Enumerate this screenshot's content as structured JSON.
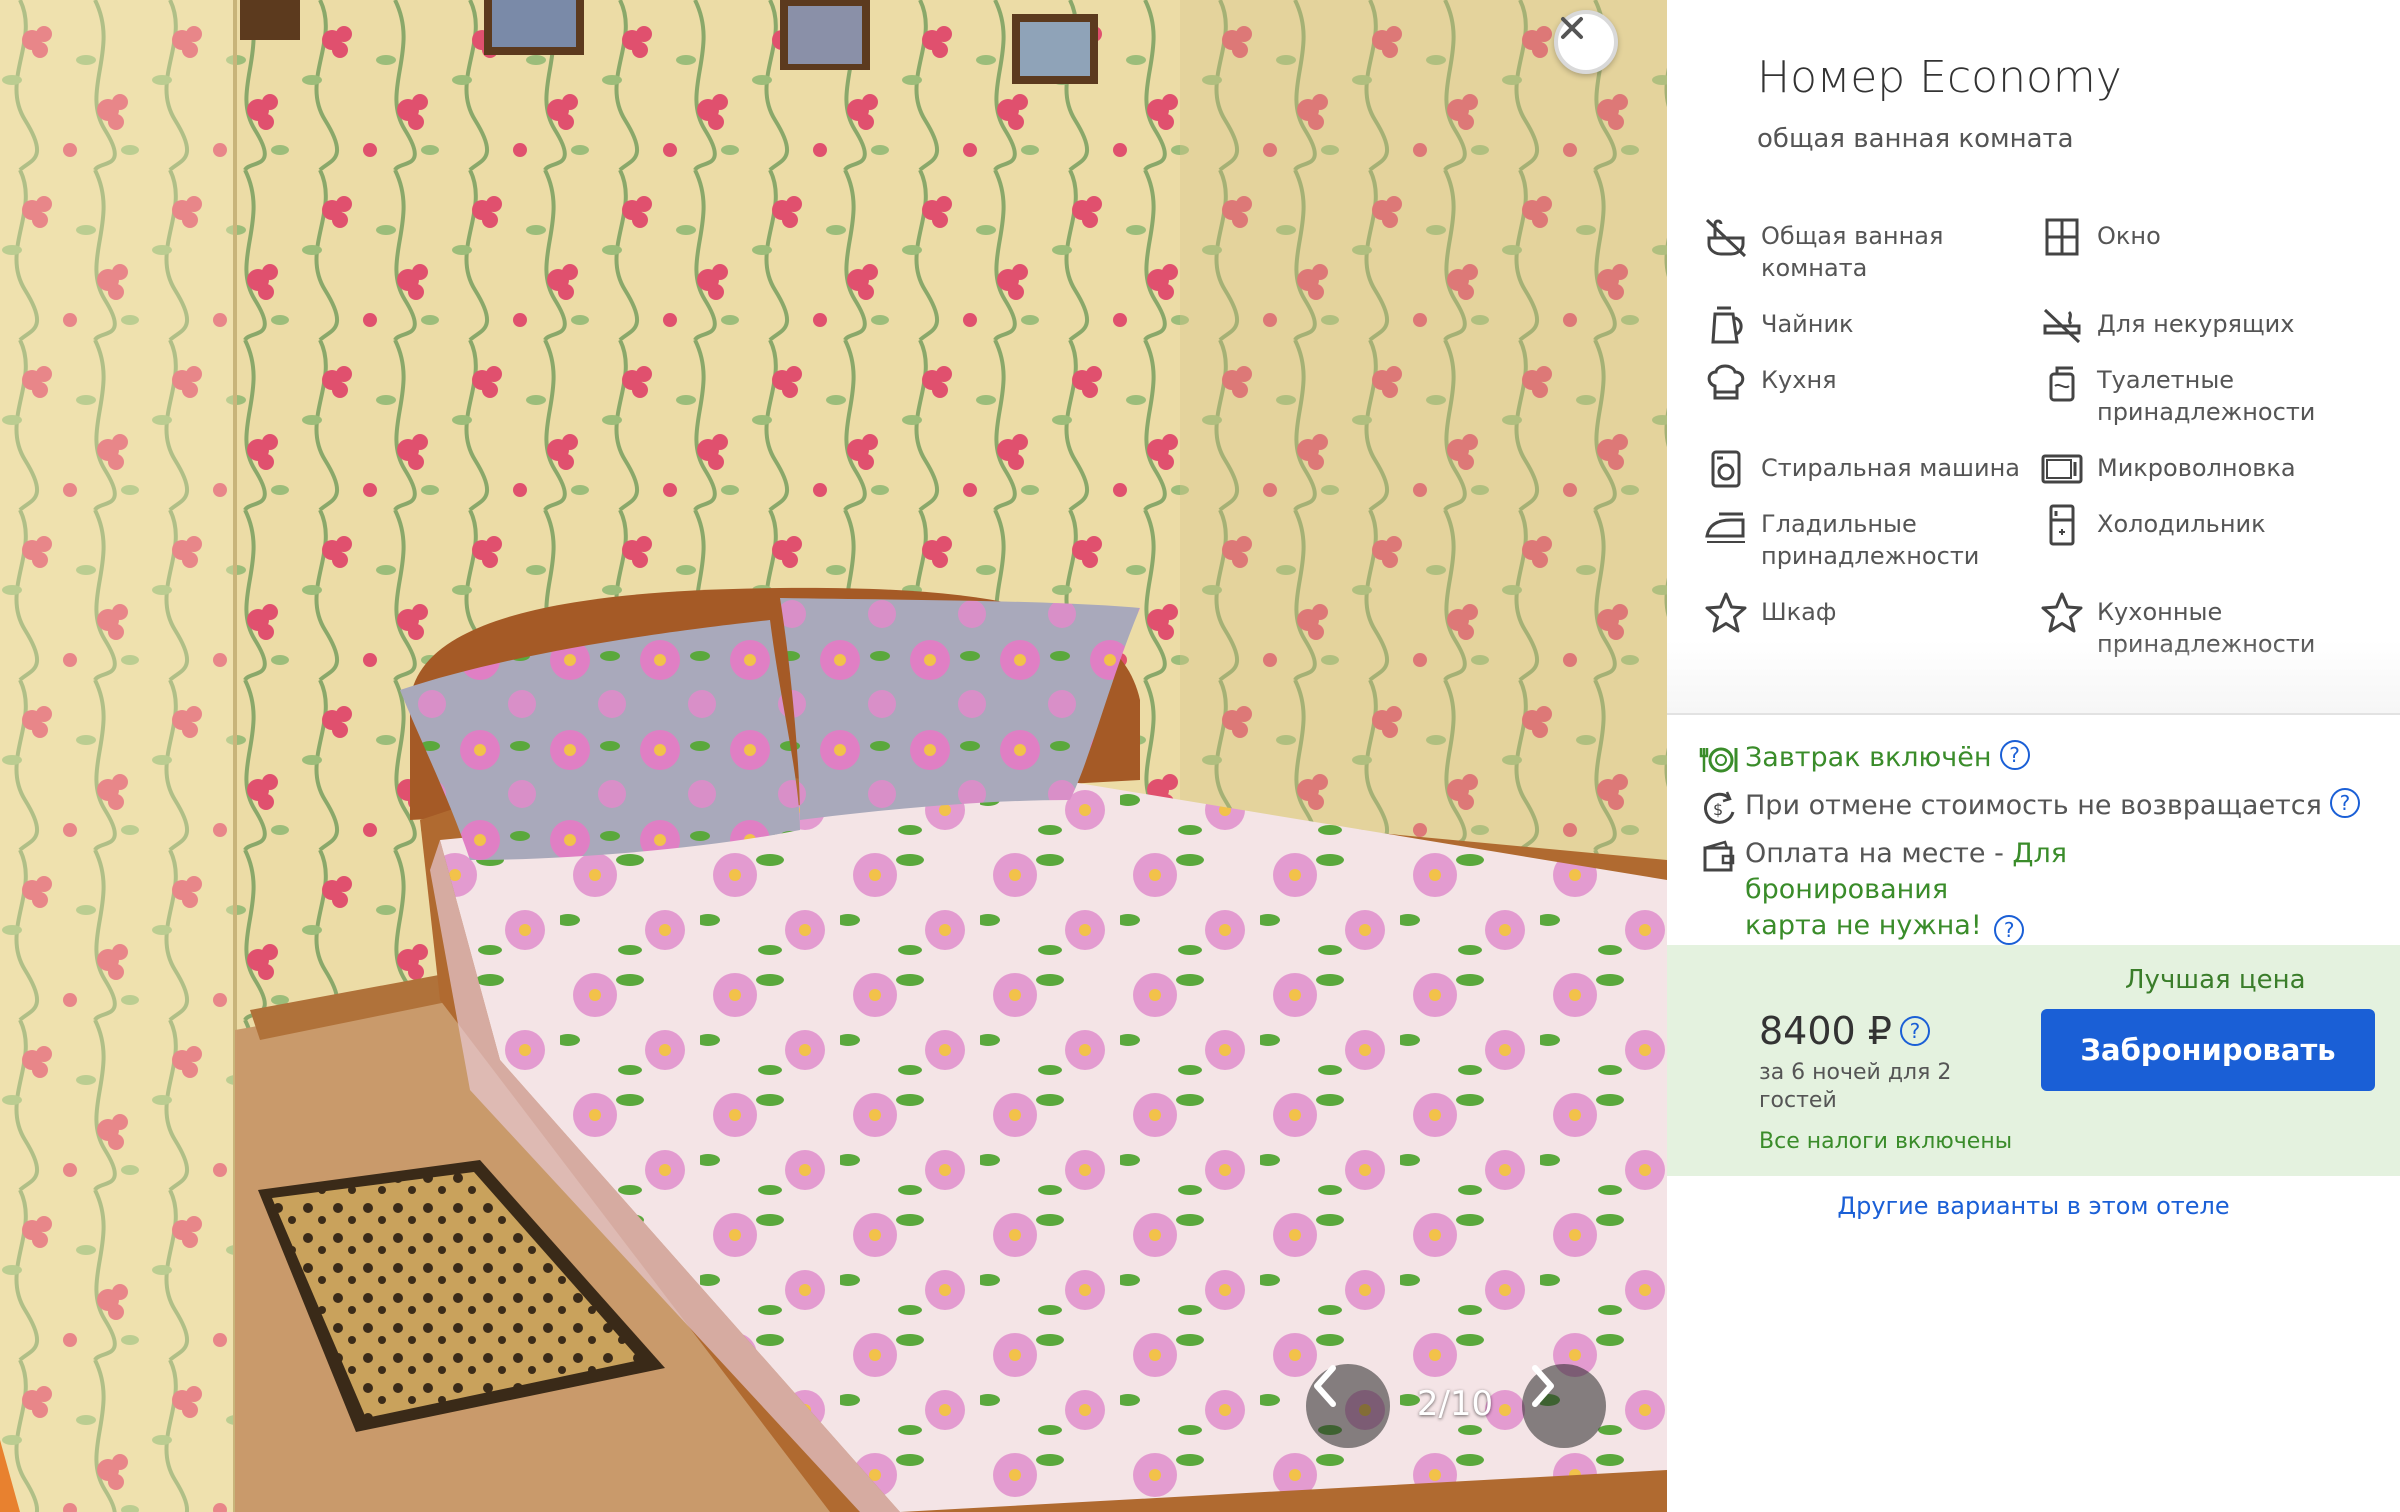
{
  "gallery": {
    "counter": "2/10",
    "close_icon": "close-icon",
    "prev_icon": "chevron-left-icon",
    "next_icon": "chevron-right-icon"
  },
  "room": {
    "title": "Номер Economy",
    "subtitle": "общая ванная комната"
  },
  "amenities": [
    {
      "icon": "shared-bath-icon",
      "label": "Общая ванная комната"
    },
    {
      "icon": "window-icon",
      "label": "Окно"
    },
    {
      "icon": "kettle-icon",
      "label": "Чайник"
    },
    {
      "icon": "no-smoking-icon",
      "label": "Для некурящих"
    },
    {
      "icon": "chef-hat-icon",
      "label": "Кухня"
    },
    {
      "icon": "toiletries-icon",
      "label": "Туалетные принадлежности"
    },
    {
      "icon": "washing-machine-icon",
      "label": "Стиральная машина"
    },
    {
      "icon": "microwave-icon",
      "label": "Микроволновка"
    },
    {
      "icon": "iron-icon",
      "label": "Гладильные принадлежности"
    },
    {
      "icon": "fridge-icon",
      "label": "Холодильник"
    },
    {
      "icon": "star-icon",
      "label": "Шкаф"
    },
    {
      "icon": "star-icon",
      "label": "Кухонные принадлежности"
    }
  ],
  "conditions": {
    "breakfast": "Завтрак включён",
    "cancellation": "При отмене стоимость не возвращается",
    "payment_prefix": "Оплата на месте - ",
    "payment_link_1": "Для бронирования",
    "payment_link_2": "карта не нужна!",
    "help_mark": "?"
  },
  "offer": {
    "best_price": "Лучшая цена",
    "price": "8400 ₽",
    "per_nights": "за 6 ночей для 2 гостей",
    "taxes": "Все налоги включены",
    "book_button": "Забронировать",
    "other_options": "Другие варианты в этом отеле"
  },
  "colors": {
    "accent_blue": "#1a5fd6",
    "green_text": "#3a8c2a",
    "price_bg": "#e4f2df"
  }
}
